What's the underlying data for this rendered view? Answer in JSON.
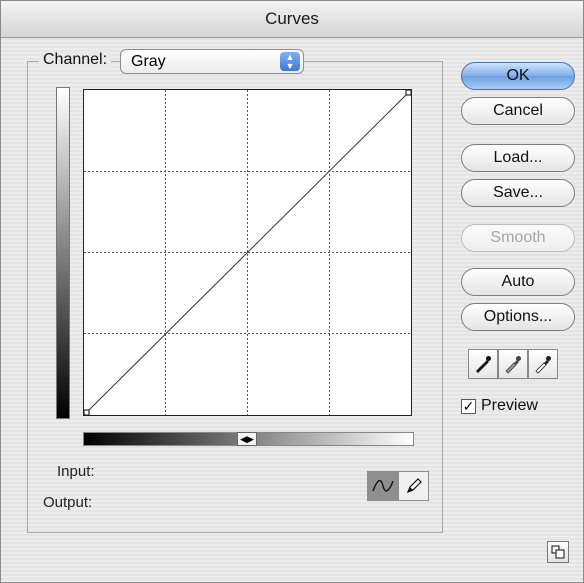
{
  "window": {
    "title": "Curves"
  },
  "channel": {
    "label": "Channel:",
    "value": "Gray"
  },
  "readout": {
    "input_label": "Input:",
    "output_label": "Output:"
  },
  "buttons": {
    "ok": "OK",
    "cancel": "Cancel",
    "load": "Load...",
    "save": "Save...",
    "smooth": "Smooth",
    "auto": "Auto",
    "options": "Options..."
  },
  "preview": {
    "label": "Preview",
    "checked": true
  },
  "eyedroppers": [
    "black-eyedropper-icon",
    "gray-eyedropper-icon",
    "white-eyedropper-icon"
  ],
  "curve_tools": [
    "curve-point-tool-icon",
    "pencil-tool-icon"
  ],
  "colors": {
    "default_button": "#6d9fe0",
    "disabled_text": "#a6a6a6"
  }
}
